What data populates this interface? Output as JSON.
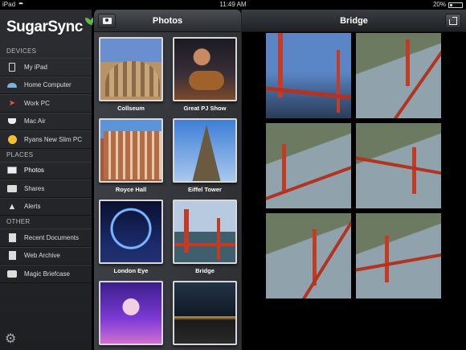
{
  "status_bar": {
    "device": "iPad",
    "time": "11:49 AM",
    "battery": "20%"
  },
  "sidebar": {
    "logo": "SugarSync",
    "sections": {
      "devices": "DEVICES",
      "places": "PLACES",
      "other": "OTHER"
    },
    "devices": [
      {
        "label": "My iPad",
        "icon": "ipad-icon"
      },
      {
        "label": "Home Computer",
        "icon": "laptop-icon"
      },
      {
        "label": "Work PC",
        "icon": "rocket-icon"
      },
      {
        "label": "Mac Air",
        "icon": "coffee-icon"
      },
      {
        "label": "Ryans New Slim PC",
        "icon": "smiley-icon"
      }
    ],
    "places": [
      {
        "label": "Photos",
        "icon": "photos-icon"
      },
      {
        "label": "Shares",
        "icon": "shares-icon"
      },
      {
        "label": "Alerts",
        "icon": "alert-icon"
      }
    ],
    "other": [
      {
        "label": "Recent Documents",
        "icon": "document-icon"
      },
      {
        "label": "Web Archive",
        "icon": "archive-icon"
      },
      {
        "label": "Magic Briefcase",
        "icon": "briefcase-icon"
      }
    ]
  },
  "photos_panel": {
    "title": "Photos",
    "albums": [
      {
        "label": "Collseum",
        "theme": "colosseum"
      },
      {
        "label": "Great PJ Show",
        "theme": "pj"
      },
      {
        "label": "Royce Hall",
        "theme": "royce"
      },
      {
        "label": "Eiffel Tower",
        "theme": "eiffel"
      },
      {
        "label": "London Eye",
        "theme": "londoneye"
      },
      {
        "label": "Bridge",
        "theme": "bridge"
      },
      {
        "label": "",
        "theme": "concert"
      },
      {
        "label": "",
        "theme": "city"
      }
    ]
  },
  "bridge_panel": {
    "title": "Bridge",
    "photo_count": 6
  }
}
